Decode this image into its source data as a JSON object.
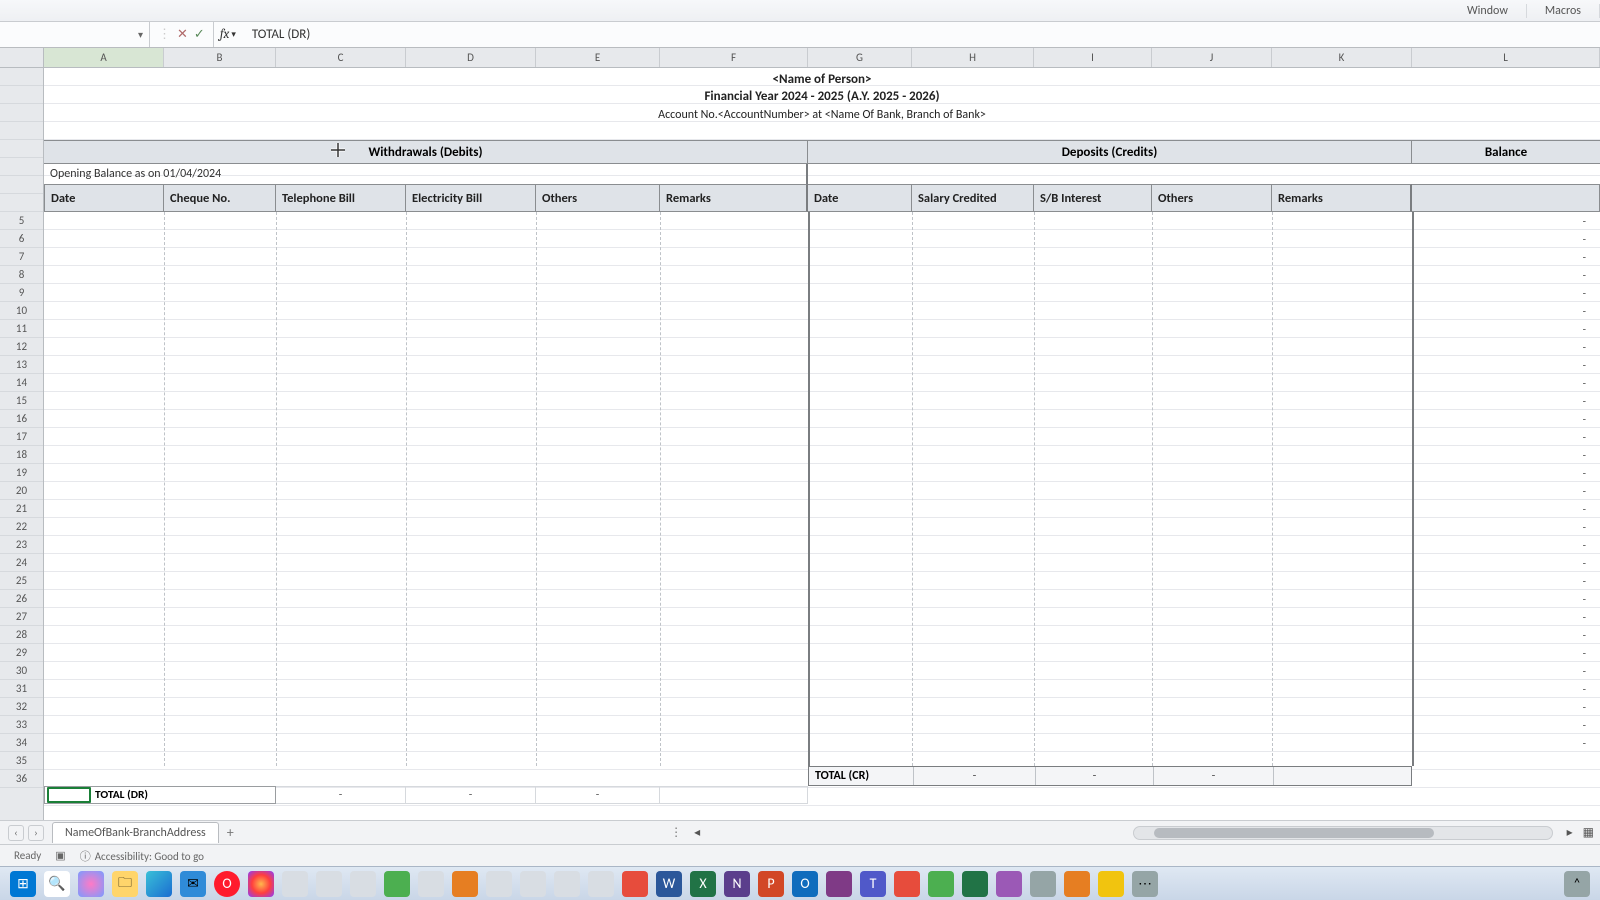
{
  "ribbon": {
    "group_window": "Window",
    "group_macros": "Macros"
  },
  "formula_bar": {
    "name_box": "",
    "fx": "fx",
    "value": "TOTAL (DR)"
  },
  "columns": [
    "A",
    "B",
    "C",
    "D",
    "E",
    "F",
    "G",
    "H",
    "I",
    "J",
    "K",
    "L"
  ],
  "title": {
    "person": "<Name of Person>",
    "fy": "Financial Year 2024 - 2025 (A.Y. 2025 - 2026)",
    "account": "Account No.<AccountNumber> at <Name Of Bank, Branch of Bank>"
  },
  "sections": {
    "withdrawals": "Withdrawals (Debits)",
    "deposits": "Deposits (Credits)",
    "balance": "Balance"
  },
  "opening_balance": "Opening Balance as on 01/04/2024",
  "headers": {
    "date1": "Date",
    "cheque": "Cheque No.",
    "tel": "Telephone Bill",
    "elec": "Electricity Bill",
    "oth1": "Others",
    "rem1": "Remarks",
    "date2": "Date",
    "sal": "Salary Credited",
    "sbi": "S/B Interest",
    "oth2": "Others",
    "rem2": "Remarks"
  },
  "totals": {
    "cr_label": "TOTAL (CR)",
    "dr_label": "TOTAL (DR)",
    "dash": "-"
  },
  "balance_dash": "-",
  "row_numbers_start": 5,
  "row_numbers_end": 36,
  "sheet_tab": "NameOfBank-BranchAddress",
  "status": {
    "ready": "Ready",
    "accessibility": "Accessibility: Good to go"
  }
}
